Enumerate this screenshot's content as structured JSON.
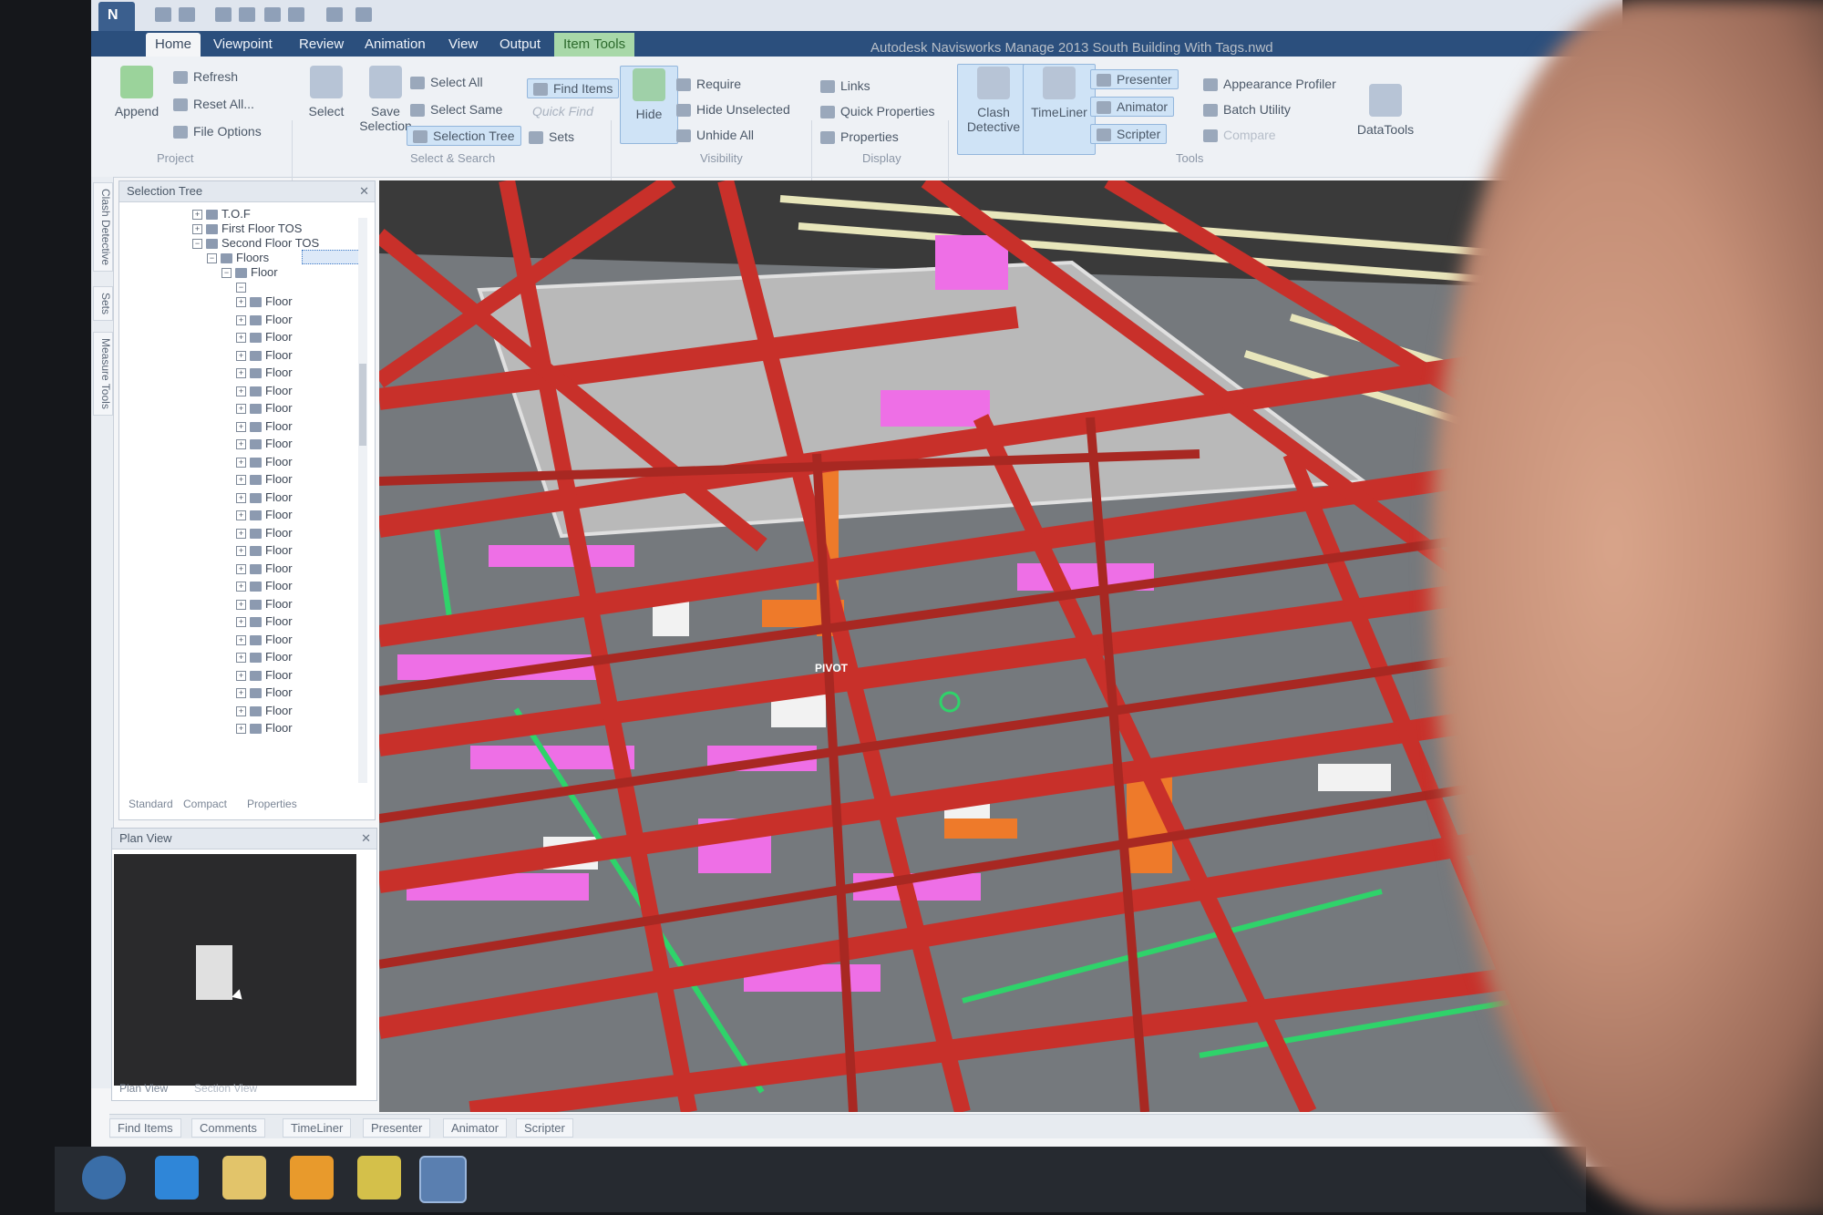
{
  "window": {
    "title": "Autodesk Navisworks Manage 2013    South Building With Tags.nwd"
  },
  "tabs": [
    "Home",
    "Viewpoint",
    "Review",
    "Animation",
    "View",
    "Output",
    "Item Tools"
  ],
  "ribbon": {
    "project": {
      "append": "Append",
      "refresh": "Refresh",
      "reset_all": "Reset All...",
      "file_options": "File Options",
      "group": "Project"
    },
    "select_search": {
      "select": "Select",
      "save_selection": "Save Selection",
      "select_all": "Select All",
      "select_same": "Select Same",
      "selection_tree": "Selection Tree",
      "find_items": "Find Items",
      "quick_find": "Quick Find",
      "sets": "Sets",
      "group": "Select & Search"
    },
    "visibility": {
      "hide": "Hide",
      "require": "Require",
      "hide_unselected": "Hide Unselected",
      "unhide_all": "Unhide All",
      "group": "Visibility"
    },
    "display": {
      "links": "Links",
      "quick_properties": "Quick Properties",
      "properties": "Properties",
      "group": "Display"
    },
    "tools": {
      "clash_detective": "Clash Detective",
      "timeliner": "TimeLiner",
      "presenter": "Presenter",
      "animator": "Animator",
      "scripter": "Scripter",
      "appearance_profiler": "Appearance Profiler",
      "batch_utility": "Batch Utility",
      "compare": "Compare",
      "datatools": "DataTools",
      "group": "Tools"
    }
  },
  "side_tabs": [
    "Clash Detective",
    "Sets",
    "Measure Tools"
  ],
  "selection_tree": {
    "title": "Selection Tree",
    "items": [
      {
        "label": "T.O.F",
        "indent": 0
      },
      {
        "label": "First Floor TOS",
        "indent": 0
      },
      {
        "label": "Second Floor TOS",
        "indent": 0
      },
      {
        "label": "Floors",
        "indent": 1
      },
      {
        "label": "Floor",
        "indent": 2
      },
      {
        "label": "",
        "indent": 3
      }
    ],
    "floor_label": "Floor",
    "floor_count": 25,
    "bottom_tabs": [
      "Standard",
      "Compact",
      "Properties"
    ]
  },
  "plan_view": {
    "title": "Plan View",
    "tabs": [
      "Plan View",
      "Section View"
    ]
  },
  "bottom_tabs": [
    "Find Items",
    "Comments",
    "TimeLiner",
    "Presenter",
    "Animator",
    "Scripter"
  ],
  "viewport": {
    "pivot_label": "PIVOT"
  },
  "colors": {
    "steel": "#c8302a",
    "duct": "#ee6fe6",
    "pipe_green": "#2fd36a",
    "slab": "#b8b8b8",
    "ribbon_tab": "#2b4f7d"
  }
}
